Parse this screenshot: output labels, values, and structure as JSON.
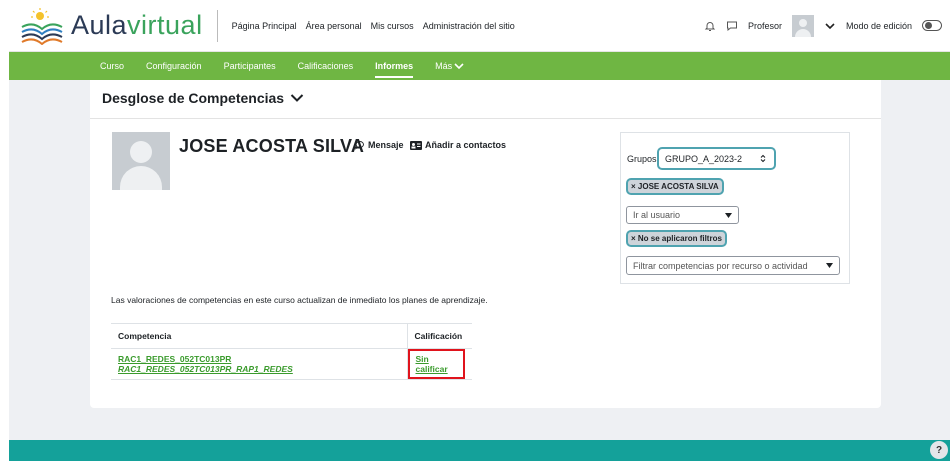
{
  "site": {
    "logo_text_a": "Aula",
    "logo_text_b": "virtual"
  },
  "topnav": [
    "Página Principal",
    "Área personal",
    "Mis cursos",
    "Administración del sitio"
  ],
  "topright": {
    "user_name": "Profesor",
    "edit_mode_label": "Modo de edición"
  },
  "secnav": [
    {
      "label": "Curso"
    },
    {
      "label": "Configuración"
    },
    {
      "label": "Participantes"
    },
    {
      "label": "Calificaciones"
    },
    {
      "label": "Informes",
      "active": true
    },
    {
      "label": "Más"
    }
  ],
  "page": {
    "title": "Desglose de Competencias"
  },
  "user": {
    "name": "JOSE ACOSTA SILVA",
    "message_label": "Mensaje",
    "add_contact_label": "Añadir a contactos"
  },
  "filters": {
    "groups_label": "Grupos",
    "group_value": "GRUPO_A_2023-2",
    "user_chip": "× JOSE ACOSTA SILVA",
    "goto_user_placeholder": "Ir al usuario",
    "no_filter_chip": "× No se aplicaron filtros",
    "filter_placeholder": "Filtrar competencias por recurso o actividad"
  },
  "note": "Las valoraciones de competencias en este curso actualizan de inmediato los planes de aprendizaje.",
  "table": {
    "headers": [
      "Competencia",
      "Calificación"
    ],
    "rows": [
      {
        "code": "RAC1_REDES_052TC013PR",
        "name": "RAC1_REDES_052TC013PR_RAP1_REDES",
        "grade": "Sin calificar"
      }
    ]
  },
  "help": "?",
  "colors": {
    "accent_green": "#6fb643",
    "footer_teal": "#14a19a",
    "highlight_red": "#e0131c",
    "link_green": "#3a9b2c"
  }
}
